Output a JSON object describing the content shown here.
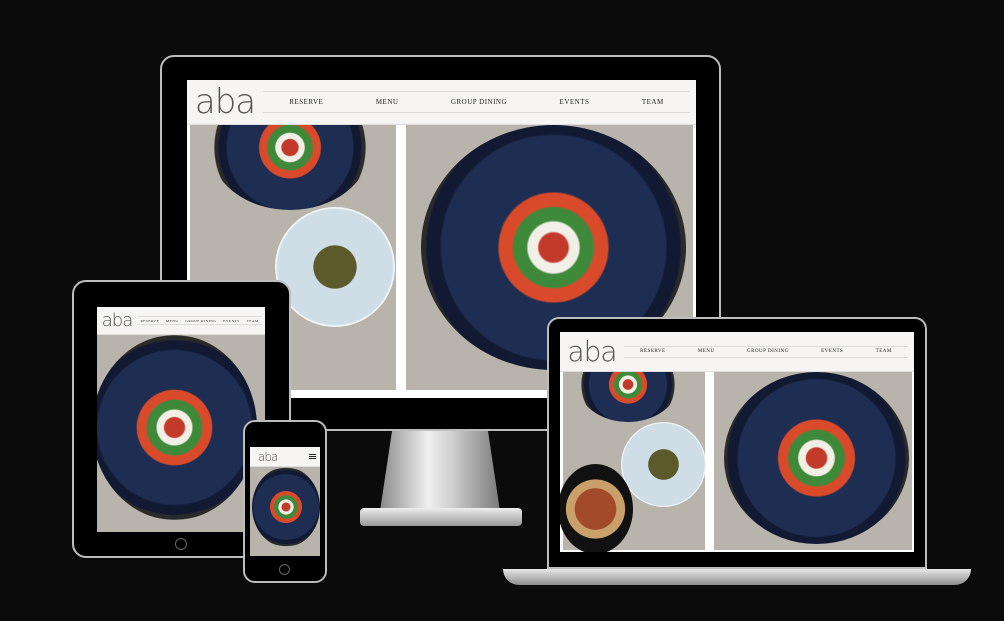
{
  "site": {
    "logo": "aba",
    "nav": [
      "Reserve",
      "Menu",
      "Group Dining",
      "Events",
      "Team"
    ]
  },
  "devices": [
    "desktop-monitor",
    "tablet",
    "phone",
    "laptop"
  ],
  "icons": {
    "menu": "hamburger-icon"
  },
  "colors": {
    "background": "#0c0b0c",
    "nav_bg": "#f6f5f3",
    "plate": "#1e2d52"
  }
}
